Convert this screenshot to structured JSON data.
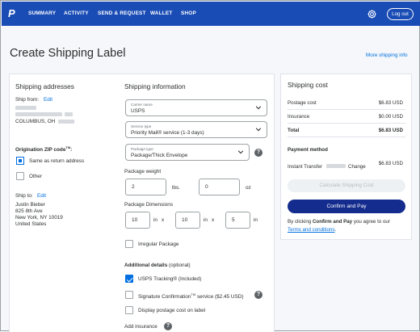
{
  "nav": {
    "logo": "P",
    "items": [
      "SUMMARY",
      "ACTIVITY",
      "SEND & REQUEST",
      "WALLET",
      "SHOP"
    ],
    "logout_label": "Log out"
  },
  "header": {
    "title": "Create Shipping Label",
    "more_link": "More shipping info"
  },
  "addresses": {
    "title": "Shipping addresses",
    "ship_from_label": "Ship from:",
    "ship_from_edit": "Edit",
    "ship_from_city": "COLUMBUS, OH",
    "zip_label": "Origination ZIP code",
    "zip_sup": "TM",
    "zip_colon": ":",
    "option_same": "Same as return address",
    "option_other": "Other",
    "ship_to_label": "Ship to:",
    "ship_to_edit": "Edit",
    "ship_to_lines": [
      "Justin Bieber",
      "825 8th Ave",
      "New York, NY 10019",
      "United States"
    ]
  },
  "shipping_info": {
    "title": "Shipping information",
    "carrier_label": "Carrier name",
    "carrier_value": "USPS",
    "service_label": "Service type",
    "service_value": "Priority Mail® service (1-3 days)",
    "package_label": "Package type",
    "package_value": "Package/Thick Envelope",
    "weight_label": "Package weight",
    "weight_lbs": "2",
    "lbs_unit": "lbs.",
    "weight_oz": "0",
    "oz_unit": "oz",
    "dimensions_label": "Package Dimensions",
    "dim_l": "10",
    "dim_w": "10",
    "dim_h": "5",
    "in_unit": "in",
    "x_sep": "x",
    "irregular_label": "Irregular Package",
    "additional_label": "Additional details",
    "optional_label": "(optional)",
    "tracking_label": "USPS Tracking® (Included)",
    "signature_label": "Signature Confirmation",
    "signature_tm": "TM",
    "signature_suffix": "service ($2.45 USD)",
    "display_cost_label": "Display postage cost on label",
    "insurance_label": "Add insurance",
    "help_glyph": "?"
  },
  "cost": {
    "title": "Shipping cost",
    "postage_label": "Postage cost",
    "postage_value": "$6.83 USD",
    "insurance_label": "Insurance",
    "insurance_value": "$0.00 USD",
    "total_label": "Total",
    "total_value": "$6.83 USD",
    "payment_title": "Payment method",
    "payment_method": "Instant Transfer",
    "payment_change": "Change",
    "payment_value": "$6.83 USD",
    "calc_button": "Calculate Shipping Cost",
    "pay_button": "Confirm and Pay",
    "terms_prefix": "By clicking ",
    "terms_bold": "Confirm and Pay",
    "terms_mid": " you agree to our",
    "terms_link": "Terms and conditions",
    "terms_end": "."
  },
  "colors": {
    "nav_bg": "#1a4cb5",
    "link": "#0070e0",
    "primary_button": "#142c8e",
    "page_bg": "#f5f7fa"
  },
  "icons": [
    "paypal-logo-icon",
    "gear-icon",
    "chevron-down-icon",
    "help-icon",
    "checkmark-icon"
  ]
}
